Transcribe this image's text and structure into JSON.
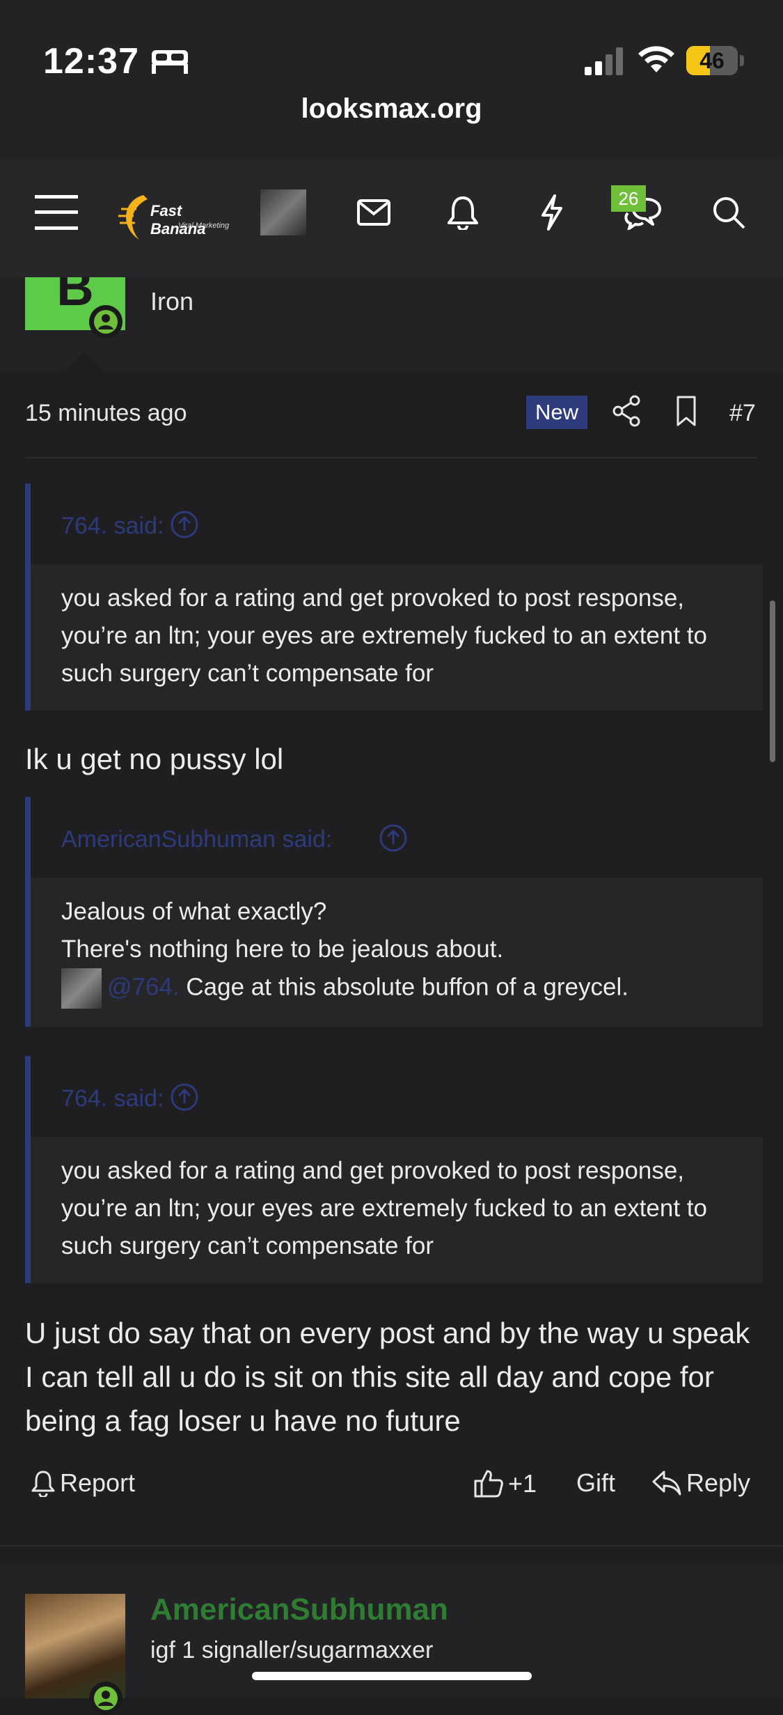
{
  "status_bar": {
    "time": "12:37",
    "battery": "46",
    "battery_level": 0.46
  },
  "browser": {
    "url": "looksmax.org"
  },
  "nav": {
    "logo_brand": "Fast Banana",
    "logo_tagline": "Viral Marketing",
    "conversations_badge": "26"
  },
  "post": {
    "user_title": "Iron",
    "avatar_letter": "B",
    "time_ago": "15 minutes ago",
    "new_label": "New",
    "post_number": "#7",
    "quotes": [
      {
        "author": "764. said:",
        "text": "you asked for a rating and get provoked to post response, you’re an ltn; your eyes are extremely fucked to an extent to such surgery can’t compensate for"
      },
      {
        "author": "AmericanSubhuman said:",
        "line1": "Jealous of what exactly?",
        "line2": "There's nothing here to be jealous about.",
        "mention": "@764.",
        "line3": " Cage at this absolute buffon of a greycel."
      },
      {
        "author": "764. said:",
        "text": "you asked for a rating and get provoked to post response, you’re an ltn; your eyes are extremely fucked to an extent to such surgery can’t compensate for"
      }
    ],
    "reply_1": "Ik u get no pussy lol",
    "reply_2": "U just do say that on every post and by the way u speak I can tell all u do is sit on this site all day and cope for being a fag loser u have no future",
    "actions": {
      "report": "Report",
      "like": "+1",
      "gift": "Gift",
      "reply": "Reply"
    }
  },
  "next_post": {
    "username": "AmericanSubhuman",
    "user_title": "igf 1 signaller/sugarmaxxer"
  },
  "colors": {
    "accent_blue": "#2d3a7c",
    "online_green": "#6fbf3a",
    "avatar_green": "#5dca4a",
    "username_green": "#2e7d32"
  }
}
